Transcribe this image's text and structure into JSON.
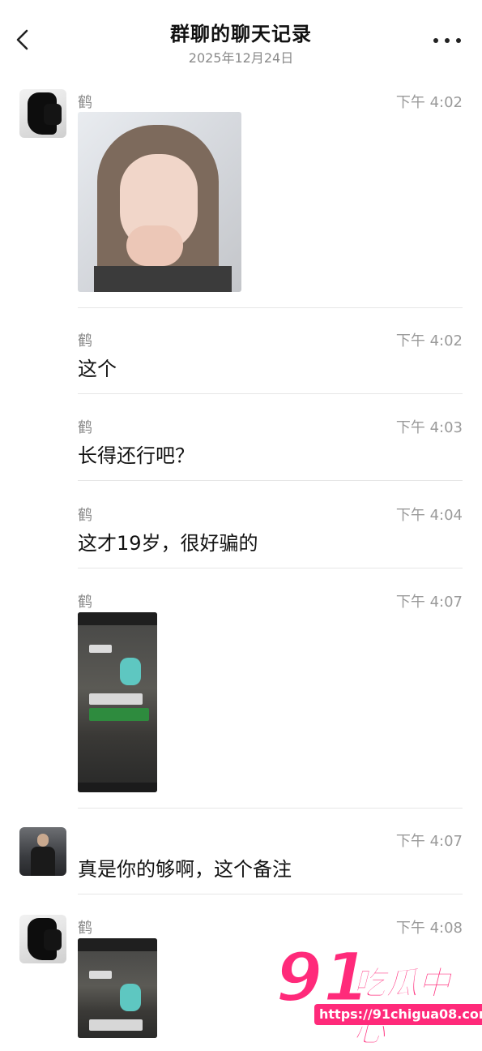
{
  "header": {
    "title": "群聊的聊天记录",
    "subtitle": "2025年12月24日",
    "back_icon": "chevron-left-icon",
    "more_icon": "more-dots-icon"
  },
  "messages": [
    {
      "sender": "鹤",
      "time": "下午 4:02",
      "type": "image",
      "content": "portrait-photo"
    },
    {
      "sender": "鹤",
      "time": "下午 4:02",
      "type": "text",
      "text": "这个"
    },
    {
      "sender": "鹤",
      "time": "下午 4:03",
      "type": "text",
      "text": "长得还行吧？"
    },
    {
      "sender": "鹤",
      "time": "下午 4:04",
      "type": "text",
      "text": "这才19岁，很好骗的"
    },
    {
      "sender": "鹤",
      "time": "下午 4:07",
      "type": "image",
      "content": "chat-screenshot"
    },
    {
      "sender": "",
      "time": "下午 4:07",
      "type": "text",
      "text": "真是你的够啊，这个备注"
    },
    {
      "sender": "鹤",
      "time": "下午 4:08",
      "type": "image",
      "content": "chat-screenshot"
    }
  ],
  "watermark": {
    "number": "91",
    "text": "吃瓜中心",
    "url": "https://91chigua08.com"
  },
  "colors": {
    "watermark": "#ff2a7a",
    "divider": "#e6e6e6",
    "muted_text": "#9a9a9a"
  }
}
